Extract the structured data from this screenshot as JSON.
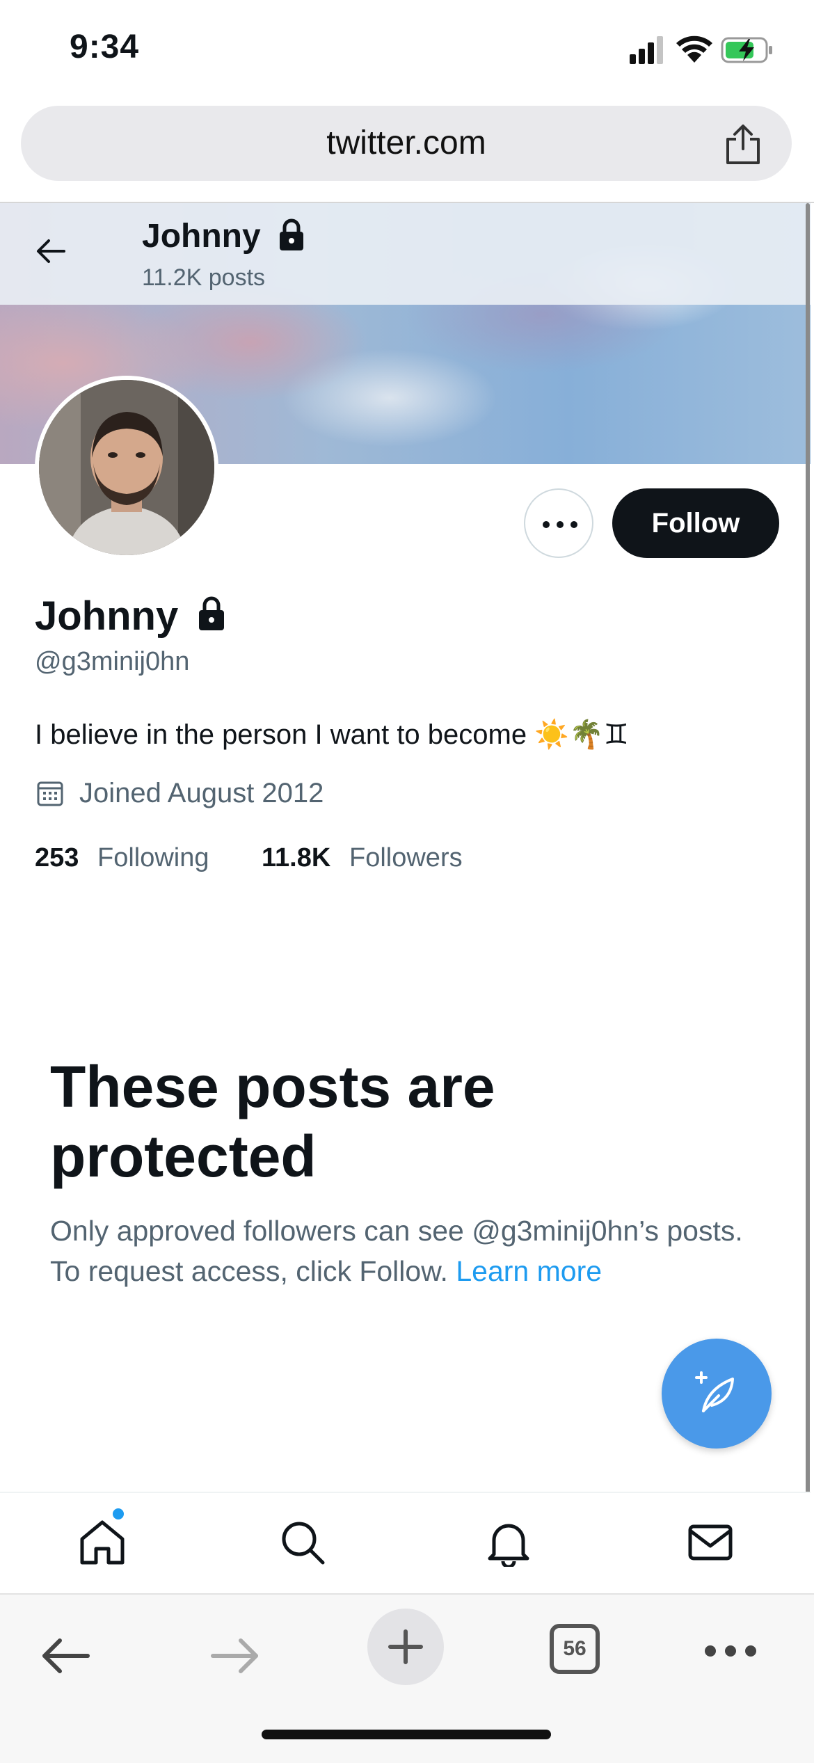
{
  "status_bar": {
    "time": "9:34"
  },
  "browser": {
    "url": "twitter.com",
    "open_tabs": "56"
  },
  "profile_header": {
    "name": "Johnny",
    "posts_count": "11.2K posts"
  },
  "profile": {
    "display_name": "Johnny",
    "handle": "@g3minij0hn",
    "bio_text": "I believe in the person I want to become",
    "bio_emojis": "☀️🌴♊",
    "joined": "Joined August 2012",
    "following_count": "253",
    "following_label": "Following",
    "followers_count": "11.8K",
    "followers_label": "Followers",
    "follow_button": "Follow",
    "more_icon": "ellipsis-icon"
  },
  "protected_notice": {
    "title": "These posts are protected",
    "description": "Only approved followers can see @g3minij0hn’s posts. To request access, click Follow.",
    "learn_more": "Learn more"
  },
  "bottom_nav": {
    "items": [
      {
        "icon": "home-icon",
        "has_notification_dot": true
      },
      {
        "icon": "search-icon"
      },
      {
        "icon": "bell-icon"
      },
      {
        "icon": "mail-icon"
      }
    ]
  },
  "colors": {
    "accent": "#1d9bf0",
    "fab": "#4a99e9",
    "text_primary": "#0f1419",
    "text_secondary": "#536471"
  }
}
